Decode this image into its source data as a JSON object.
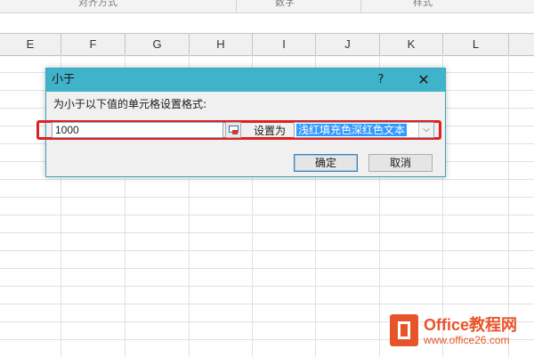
{
  "ribbon": {
    "groups": [
      "对齐方式",
      "数字",
      "样式"
    ]
  },
  "columns": [
    "E",
    "F",
    "G",
    "H",
    "I",
    "J",
    "K",
    "L"
  ],
  "dialog": {
    "title": "小于",
    "help_label": "?",
    "close_label": "✕",
    "prompt": "为小于以下值的单元格设置格式:",
    "value": "1000",
    "set_label": "设置为",
    "format_selected": "浅红填充色深红色文本",
    "dropdown_arrow": "⌵",
    "ok_label": "确定",
    "cancel_label": "取消",
    "highlight_color": "#e02020",
    "title_bar_color": "#3fb3c9"
  },
  "watermark": {
    "brand": "Office教程网",
    "url": "www.office26.com",
    "color": "#e8542a"
  }
}
